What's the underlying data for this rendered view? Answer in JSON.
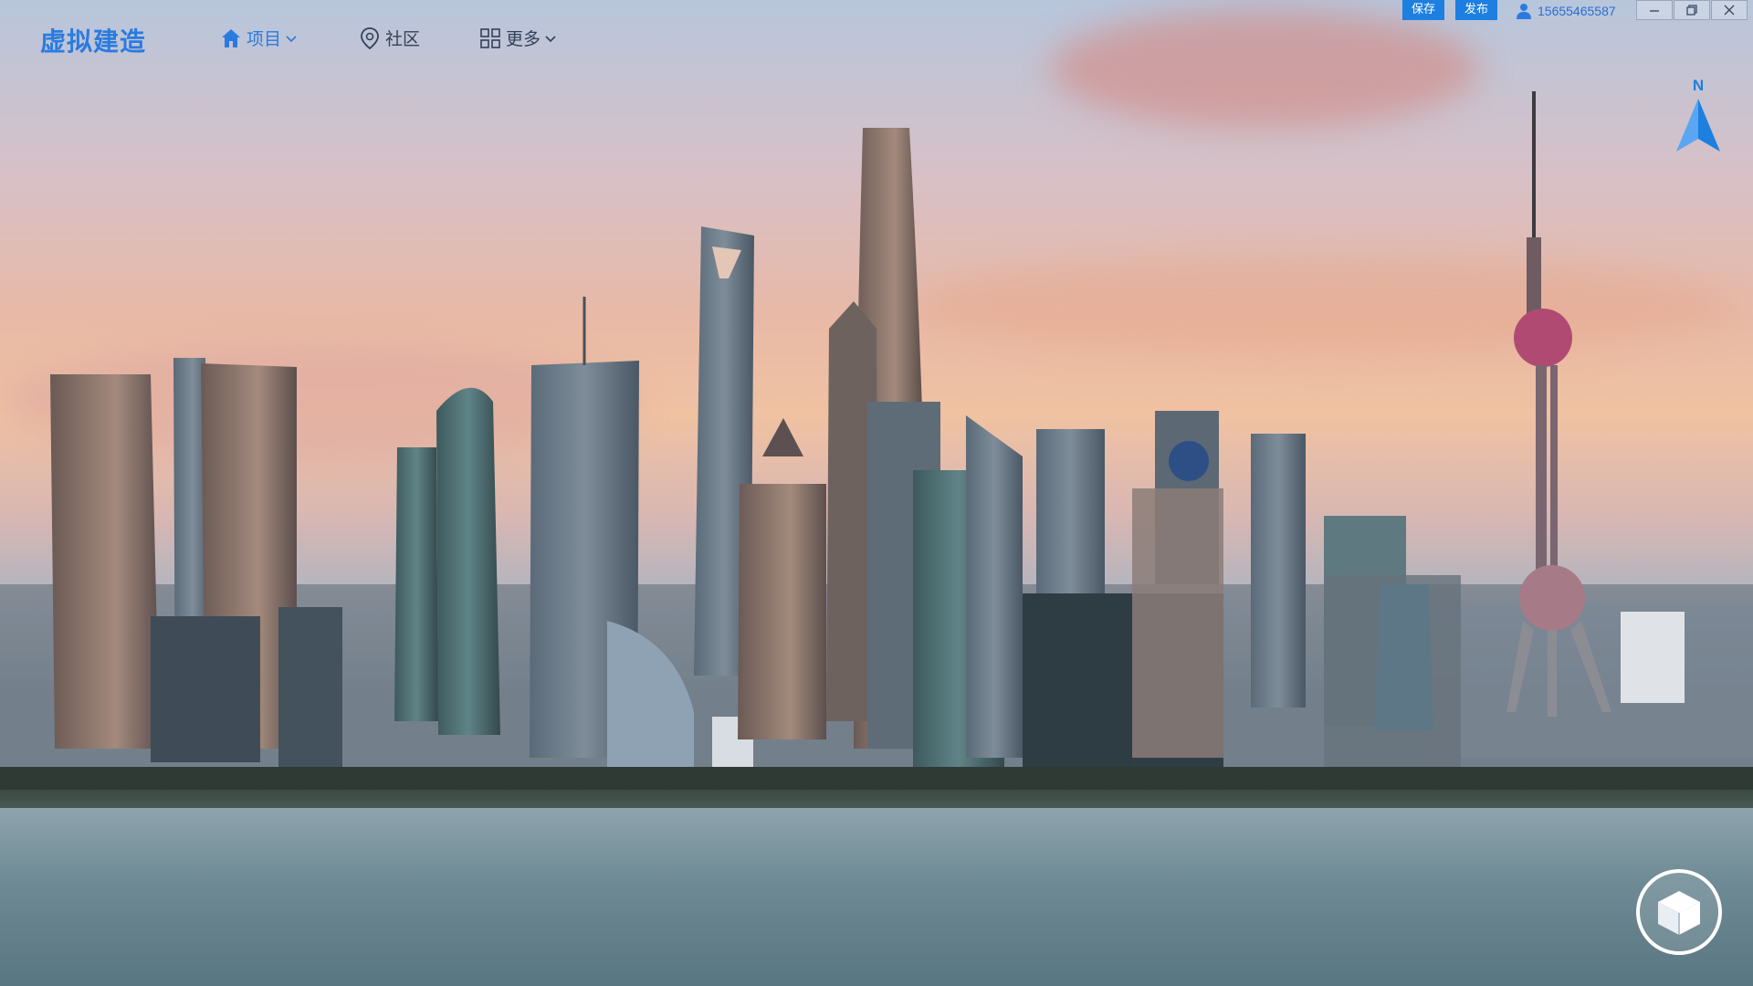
{
  "app": {
    "logo_text": "虚拟建造"
  },
  "nav": {
    "items": [
      {
        "label": "项目",
        "icon": "home-icon",
        "active": true
      },
      {
        "label": "社区",
        "icon": "location-pin-icon",
        "active": false
      },
      {
        "label": "更多",
        "icon": "grid-apps-icon",
        "active": false
      }
    ]
  },
  "toolbar": {
    "save_label": "保存",
    "publish_label": "发布"
  },
  "user": {
    "phone": "15655465587",
    "icon": "user-icon"
  },
  "window_controls": [
    "minimize-icon",
    "restore-icon",
    "close-icon"
  ],
  "compass": {
    "label": "N",
    "icon": "north-arrow-icon"
  },
  "view_cube": {
    "icon": "cube-icon"
  },
  "colors": {
    "accent": "#1d7fe0",
    "logo": "#2a7be0"
  }
}
